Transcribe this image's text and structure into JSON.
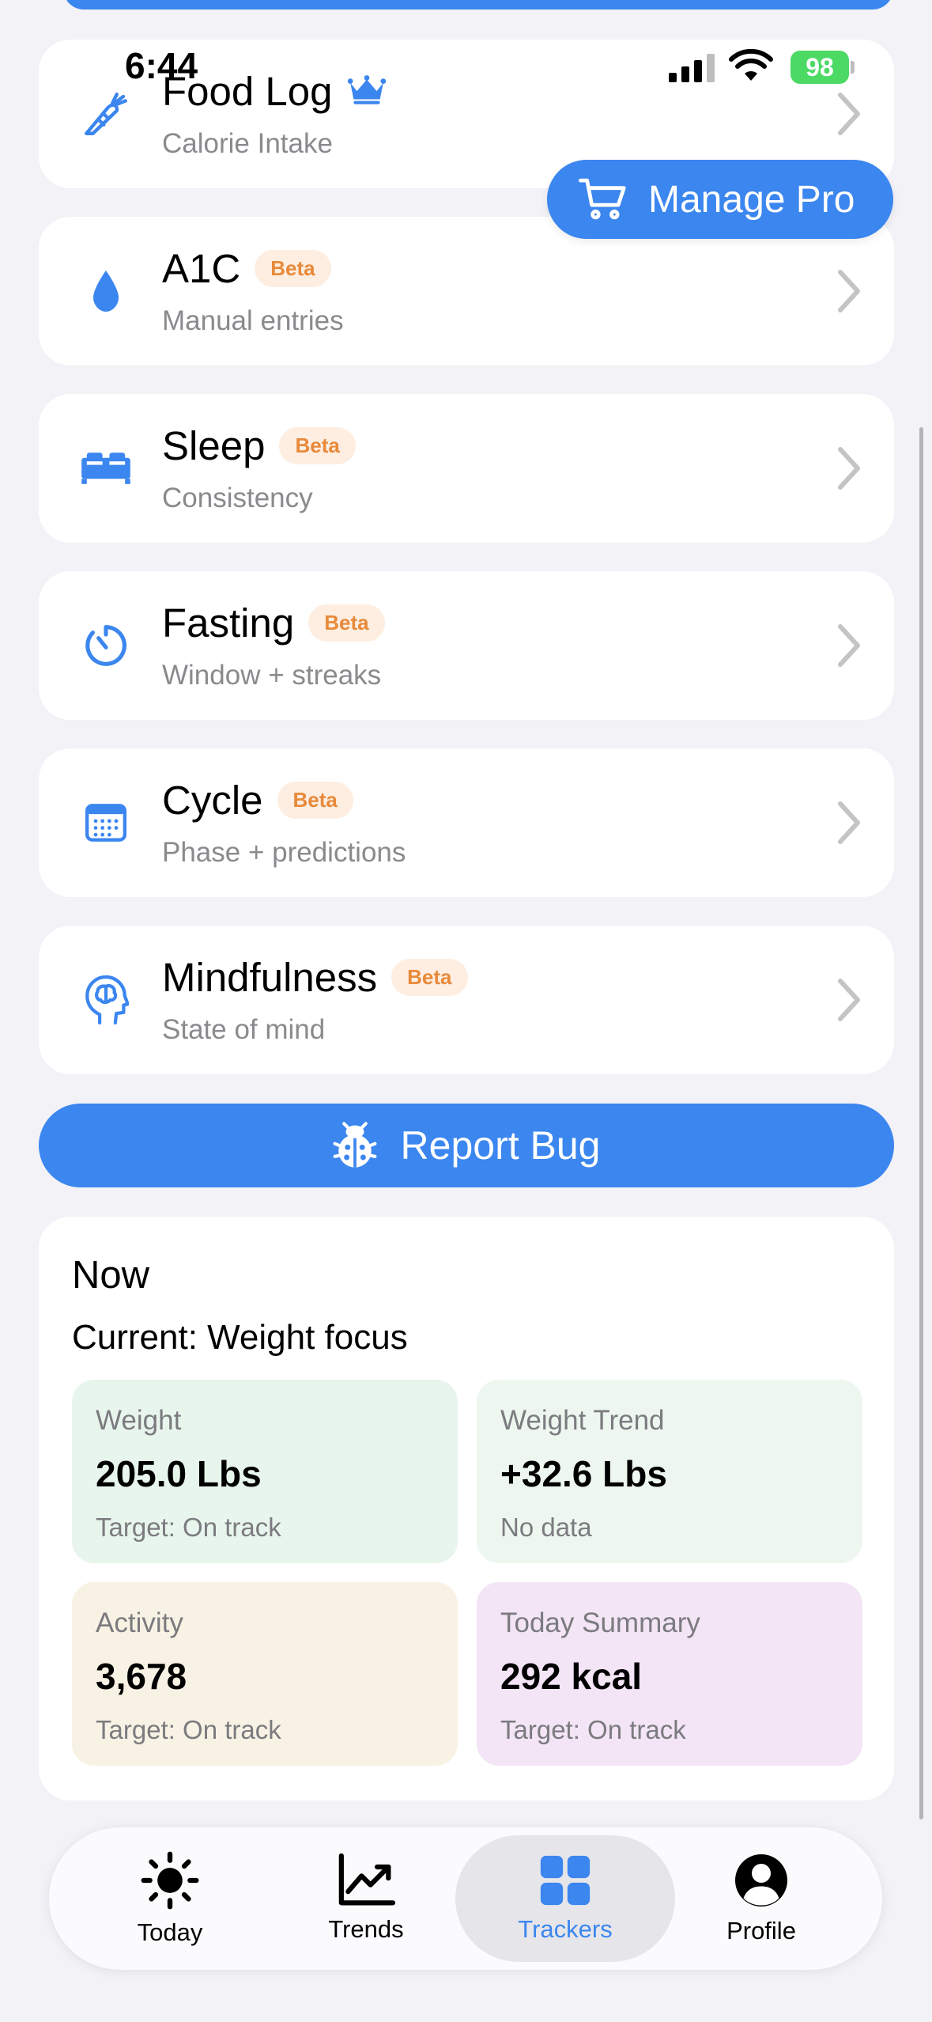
{
  "status_bar": {
    "time": "6:44",
    "battery": "98"
  },
  "manage_pro": {
    "label": "Manage Pro"
  },
  "trackers": [
    {
      "title": "Food Log",
      "subtitle": "Calorie Intake",
      "badge": "",
      "icon": "carrot-icon"
    },
    {
      "title": "A1C",
      "subtitle": "Manual entries",
      "badge": "Beta",
      "icon": "drop-icon"
    },
    {
      "title": "Sleep",
      "subtitle": "Consistency",
      "badge": "Beta",
      "icon": "bed-icon"
    },
    {
      "title": "Fasting",
      "subtitle": "Window + streaks",
      "badge": "Beta",
      "icon": "timer-icon"
    },
    {
      "title": "Cycle",
      "subtitle": "Phase + predictions",
      "badge": "Beta",
      "icon": "calendar-icon"
    },
    {
      "title": "Mindfulness",
      "subtitle": "State of mind",
      "badge": "Beta",
      "icon": "brain-head-icon"
    }
  ],
  "report_bug": {
    "label": "Report Bug"
  },
  "now": {
    "title": "Now",
    "focus": "Current: Weight focus",
    "tiles": [
      {
        "label": "Weight",
        "value": "205.0 Lbs",
        "note": "Target: On track",
        "color": "#e8f5ec"
      },
      {
        "label": "Weight Trend",
        "value": "+32.6 Lbs",
        "note": "No data",
        "color": "#edf7ef"
      },
      {
        "label": "Activity",
        "value": "3,678",
        "note": "Target: On track",
        "color": "#f8f2e4"
      },
      {
        "label": "Today Summary",
        "value": "292 kcal",
        "note": "Target: On track",
        "color": "#f3e4f6"
      }
    ]
  },
  "tabs": [
    {
      "label": "Today",
      "icon": "sun-icon"
    },
    {
      "label": "Trends",
      "icon": "chart-trend-icon"
    },
    {
      "label": "Trackers",
      "icon": "grid-icon"
    },
    {
      "label": "Profile",
      "icon": "person-circle-icon"
    }
  ],
  "colors": {
    "accent": "#3b86ef",
    "beta_text": "#e88a3b",
    "beta_bg": "#fdeee1"
  }
}
